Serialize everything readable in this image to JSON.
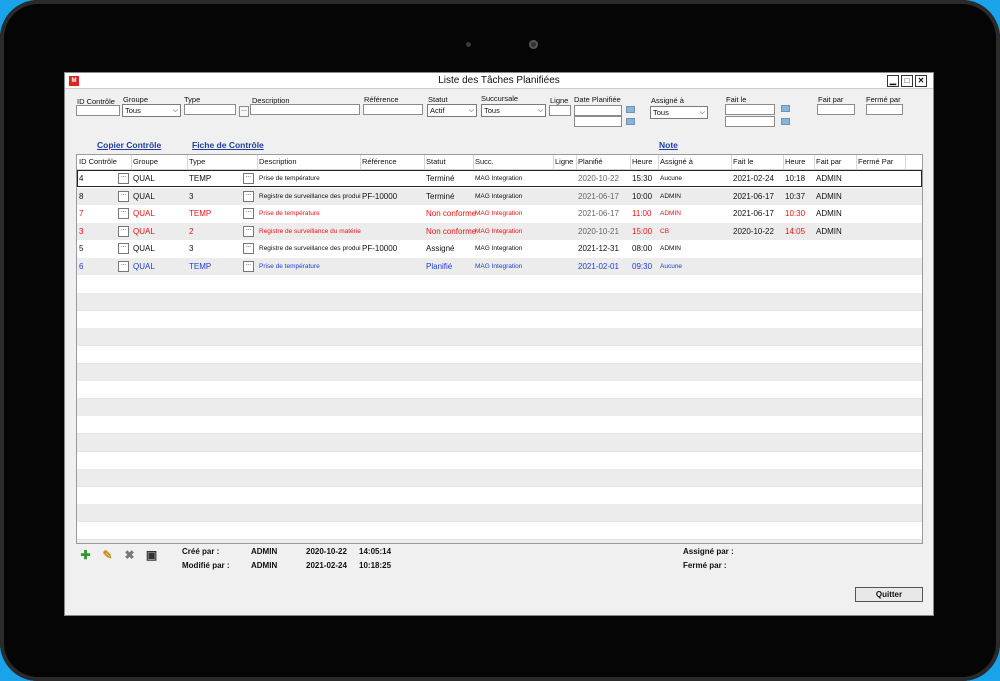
{
  "window": {
    "title": "Liste des Tâches Planifiées",
    "icon_text": "M",
    "controls": [
      "▁",
      "□",
      "✕"
    ]
  },
  "filters": {
    "id_label": "ID Contrôle",
    "id_value": "",
    "groupe_label": "Groupe",
    "groupe_value": "Tous",
    "type_label": "Type",
    "type_value": "",
    "description_label": "Description",
    "description_value": "",
    "reference_label": "Référence",
    "reference_value": "",
    "statut_label": "Statut",
    "statut_value": "Actif",
    "succursale_label": "Succursale",
    "succursale_value": "Tous",
    "ligne_label": "Ligne",
    "ligne_value": "",
    "date_label": "Date Planifiée",
    "assigne_label": "Assigné à",
    "assigne_value": "Tous",
    "fait_le_label": "Fait le",
    "fait_par_label": "Fait par",
    "ferme_par_label": "Fermé par",
    "dots": "..."
  },
  "links": {
    "copier": "Copier Contrôle",
    "fiche": "Fiche de Contrôle",
    "note": "Note"
  },
  "grid": {
    "headers": [
      "ID Contrôle",
      "Groupe",
      "Type",
      "Description",
      "Référence",
      "Statut",
      "Succ.",
      "Ligne",
      "Planifié",
      "Heure",
      "Assigné à",
      "Fait le",
      "Heure",
      "Fait par",
      "Fermé Par"
    ],
    "rows": [
      {
        "id": "4",
        "groupe": "QUAL",
        "type": "TEMP",
        "description": "Prise de température",
        "reference": "",
        "statut": "Terminé",
        "succ": "MAG Integration",
        "ligne": "",
        "planifie": "2020-10-22",
        "heure": "15:30",
        "assigne": "Aucune",
        "fait_le": "2021-02-24",
        "heure2": "10:18",
        "fait_par": "ADMIN",
        "ferme_par": ""
      },
      {
        "id": "8",
        "groupe": "QUAL",
        "type": "3",
        "description": "Registre de surveillance des produi",
        "reference": "PF-10000",
        "statut": "Terminé",
        "succ": "MAG Integration",
        "ligne": "",
        "planifie": "2021-06-17",
        "heure": "10:00",
        "assigne": "ADMIN",
        "fait_le": "2021-06-17",
        "heure2": "10:37",
        "fait_par": "ADMIN",
        "ferme_par": ""
      },
      {
        "id": "7",
        "groupe": "QUAL",
        "type": "TEMP",
        "description": "Prise de température",
        "reference": "",
        "statut": "Non conforme",
        "succ": "MAG Integration",
        "ligne": "",
        "planifie": "2021-06-17",
        "heure": "11:00",
        "assigne": "ADMIN",
        "fait_le": "2021-06-17",
        "heure2": "10:30",
        "fait_par": "ADMIN",
        "ferme_par": ""
      },
      {
        "id": "3",
        "groupe": "QUAL",
        "type": "2",
        "description": "Registre de surveillance du matérie",
        "reference": "",
        "statut": "Non conforme",
        "succ": "MAG Integration",
        "ligne": "",
        "planifie": "2020-10-21",
        "heure": "15:00",
        "assigne": "CB",
        "fait_le": "2020-10-22",
        "heure2": "14:05",
        "fait_par": "ADMIN",
        "ferme_par": ""
      },
      {
        "id": "5",
        "groupe": "QUAL",
        "type": "3",
        "description": "Registre de surveillance des produi",
        "reference": "PF-10000",
        "statut": "Assigné",
        "succ": "MAG Integration",
        "ligne": "",
        "planifie": "2021-12-31",
        "heure": "08:00",
        "assigne": "ADMIN",
        "fait_le": "",
        "heure2": "",
        "fait_par": "",
        "ferme_par": ""
      },
      {
        "id": "6",
        "groupe": "QUAL",
        "type": "TEMP",
        "description": "Prise de température",
        "reference": "",
        "statut": "Planifié",
        "succ": "MAG Integration",
        "ligne": "",
        "planifie": "2021-02-01",
        "heure": "09:30",
        "assigne": "Aucune",
        "fait_le": "",
        "heure2": "",
        "fait_par": "",
        "ferme_par": ""
      }
    ]
  },
  "footer": {
    "cree_label": "Créé par :",
    "cree_user": "ADMIN",
    "cree_date": "2020-10-22",
    "cree_time": "14:05:14",
    "modifie_label": "Modifié par :",
    "modifie_user": "ADMIN",
    "modifie_date": "2021-02-24",
    "modifie_time": "10:18:25",
    "assigne_label": "Assigné par :",
    "ferme_label": "Fermé par :",
    "quit": "Quitter"
  },
  "colors": {
    "normal": "#111111",
    "red": "#ee1111",
    "blue": "#1f3fcf",
    "link": "#1f3fa0"
  },
  "icons": [
    "add-icon",
    "edit-icon",
    "delete-icon",
    "save-icon"
  ]
}
